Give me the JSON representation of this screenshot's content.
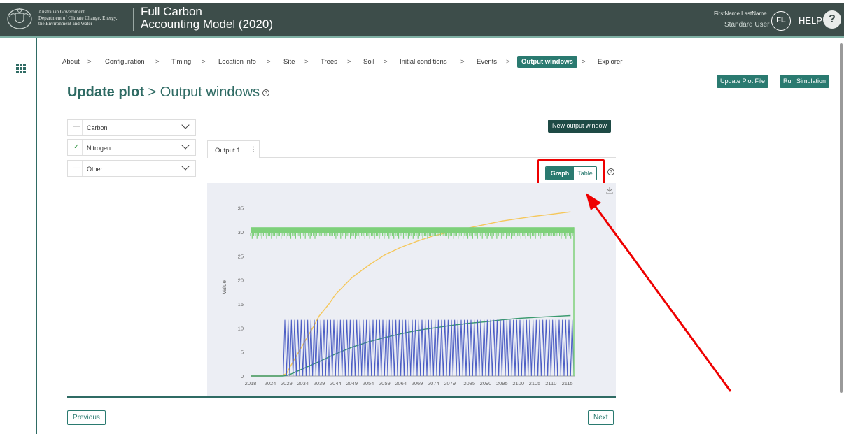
{
  "header": {
    "gov_line1": "Australian Government",
    "gov_line2": "Department of Climate Change, Energy,",
    "gov_line3": "the Environment and Water",
    "app_title_1": "Full Carbon",
    "app_title_2": "Accounting Model (2020)",
    "user_name": "FirstName LastName",
    "user_role": "Standard User",
    "avatar_initials": "FL",
    "help_label": "HELP",
    "help_glyph": "?"
  },
  "breadcrumb": {
    "items": [
      "About",
      "Configuration",
      "Timing",
      "Location info",
      "Site",
      "Trees",
      "Soil",
      "Initial conditions",
      "Events",
      "Output windows",
      "Explorer"
    ],
    "active": "Output windows",
    "separator": ">"
  },
  "actions": {
    "update_plot_file": "Update Plot File",
    "run_simulation": "Run Simulation"
  },
  "page": {
    "title_bold": "Update plot",
    "title_sep": " > ",
    "title_sub": "Output windows",
    "help_glyph": "?"
  },
  "categories": [
    {
      "label": "Carbon",
      "mark": "—",
      "checked": false
    },
    {
      "label": "Nitrogen",
      "mark": "✓",
      "checked": true
    },
    {
      "label": "Other",
      "mark": "—",
      "checked": false
    }
  ],
  "output": {
    "new_window_button": "New output window",
    "tab_label": "Output 1",
    "tab_menu": "⋮",
    "view_toggle": {
      "graph": "Graph",
      "table": "Table",
      "selected": "Graph"
    },
    "toggle_help": "?"
  },
  "chart_data": {
    "type": "line",
    "ylabel": "Value",
    "xlabel": "",
    "x_ticks": [
      2018,
      2024,
      2029,
      2034,
      2039,
      2044,
      2049,
      2054,
      2059,
      2064,
      2069,
      2074,
      2079,
      2085,
      2090,
      2095,
      2100,
      2105,
      2110,
      2115
    ],
    "y_ticks": [
      0,
      5,
      10,
      15,
      20,
      25,
      30,
      35
    ],
    "xlim": [
      2018,
      2117
    ],
    "ylim": [
      0,
      37
    ],
    "series": [
      {
        "color": "#f5c75a",
        "style": "sigmoid",
        "x": [
          2018,
          2027,
          2029,
          2031,
          2034,
          2037,
          2039,
          2042,
          2044,
          2049,
          2054,
          2059,
          2064,
          2069,
          2074,
          2079,
          2085,
          2090,
          2095,
          2100,
          2105,
          2110,
          2116
        ],
        "y": [
          0,
          0,
          0.5,
          3,
          6.5,
          10,
          12.5,
          15,
          17,
          20.5,
          23,
          25.2,
          26.8,
          28.1,
          29.2,
          30,
          30.9,
          31.6,
          32.3,
          32.8,
          33.3,
          33.7,
          34.2
        ]
      },
      {
        "color": "#3a9a6e",
        "style": "sigmoid",
        "x": [
          2018,
          2028,
          2030,
          2034,
          2039,
          2044,
          2049,
          2054,
          2059,
          2064,
          2069,
          2074,
          2079,
          2085,
          2090,
          2095,
          2100,
          2105,
          2110,
          2116
        ],
        "y": [
          0,
          0,
          0.3,
          1.5,
          3,
          4.6,
          6,
          7.1,
          8,
          8.8,
          9.5,
          10,
          10.5,
          11,
          11.3,
          11.7,
          12,
          12.2,
          12.4,
          12.6
        ]
      },
      {
        "color": "#4a5cc4",
        "style": "oscillating",
        "min": 0,
        "max": 11.7,
        "x_start": 2028,
        "x_end": 2117,
        "period_years": 1
      },
      {
        "color": "#7ed07a",
        "style": "band",
        "min": 26,
        "max": 31,
        "x_start": 2018,
        "x_end": 2117
      }
    ]
  },
  "navigation": {
    "previous": "Previous",
    "next": "Next"
  },
  "icons": {
    "apps": "grid-icon",
    "download": "download-icon",
    "crest": "coat-of-arms-icon"
  },
  "colors": {
    "header_bg": "#3d4d4a",
    "primary": "#2a7a70",
    "dark_button": "#1e4a45",
    "highlight": "#e00000"
  }
}
